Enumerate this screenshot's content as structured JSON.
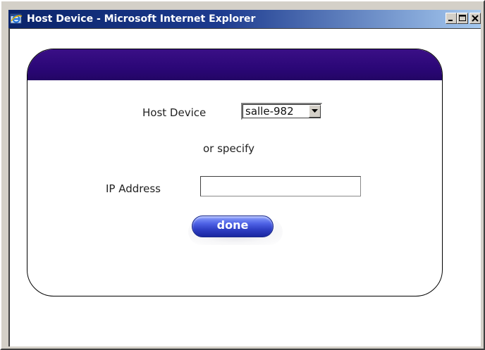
{
  "window": {
    "title": "Host Device - Microsoft Internet Explorer",
    "icon": "ie-icon",
    "controls": [
      "minimize-icon",
      "maximize-icon",
      "close-icon"
    ]
  },
  "form": {
    "host_device_label": "Host Device",
    "host_device_selected": "salle-982",
    "or_text": "or specify",
    "ip_label": "IP Address",
    "ip_value": "",
    "done_label": "done"
  },
  "colors": {
    "header": "#2b0777",
    "title_bar": "#0a246a",
    "button": "#3a4bd6"
  }
}
